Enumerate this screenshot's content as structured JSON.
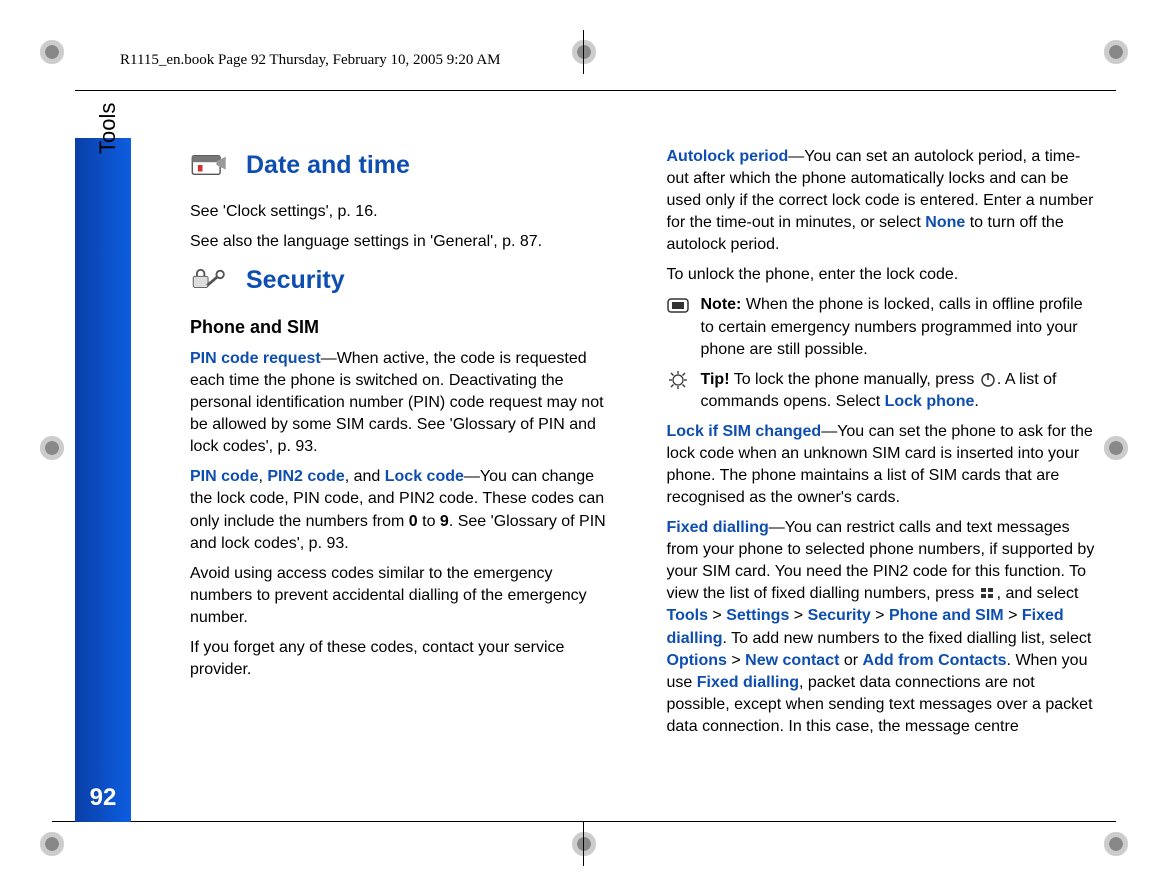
{
  "header": {
    "label": "R1115_en.book  Page 92  Thursday, February 10, 2005  9:20 AM"
  },
  "sidebar": {
    "section": "Tools",
    "page_number": "92"
  },
  "col1": {
    "h_date_time": "Date and time",
    "p_clock": "See 'Clock settings', p. 16.",
    "p_lang": "See also the language settings in 'General', p. 87.",
    "h_security": "Security",
    "h_phone_sim": "Phone and SIM",
    "pin_req_label": "PIN code request",
    "pin_req_text": "—When active, the code is requested each time the phone is switched on. Deactivating the personal identification number (PIN) code request may not be allowed by some SIM cards. See 'Glossary of PIN and lock codes', p. 93.",
    "pin_code": "PIN code",
    "pin2_code": "PIN2 code",
    "and_word": ", and ",
    "lock_code": "Lock code",
    "codes_text": "—You can change the lock code, PIN code, and PIN2 code. These codes can only include the numbers from ",
    "zero": "0",
    "to_word": " to ",
    "nine": "9",
    "codes_text2": ". See 'Glossary of PIN and lock codes', p. 93.",
    "p_avoid": "Avoid using access codes similar to the emergency numbers to prevent accidental dialling of the emergency number.",
    "p_forget": "If you forget any of these codes, contact your service provider."
  },
  "col2": {
    "autolock_label": "Autolock period",
    "autolock_text1": "—You can set an autolock period, a time-out after which the phone automatically locks and can be used only if the correct lock code is entered. Enter a number for the time-out in minutes, or select ",
    "none": "None",
    "autolock_text2": " to turn off the autolock period.",
    "p_unlock": "To unlock the phone, enter the lock code.",
    "note_label": "Note:",
    "note_text": " When the phone is locked, calls in offline profile to certain emergency numbers programmed into your phone are still possible.",
    "tip_label": "Tip!",
    "tip_text1": " To lock the phone manually, press ",
    "tip_text2": ". A list of commands opens. Select ",
    "lock_phone": "Lock phone",
    "dot": ".",
    "lock_sim_label": "Lock if SIM changed",
    "lock_sim_text": "—You can set the phone to ask for the lock code when an unknown SIM card is inserted into your phone. The phone maintains a list of SIM cards that are recognised as the owner's cards.",
    "fixed_label": "Fixed dialling",
    "fixed_text1": "—You can restrict calls and text messages from your phone to selected phone numbers, if supported by your SIM card. You need the PIN2 code for this function. To view the list of fixed dialling numbers, press ",
    "fixed_text2": ", and select ",
    "nav1": "Tools",
    "gt": " > ",
    "nav2": "Settings",
    "nav3": "Security",
    "nav4": "Phone and SIM",
    "nav5": "Fixed dialling",
    "fixed_text3": ". To add new numbers to the fixed dialling list, select ",
    "options": "Options",
    "new_contact": "New contact",
    "or_word": " or ",
    "add_from": "Add from Contacts",
    "fixed_text4": ". When you use ",
    "fixed_text5": ", packet data connections are not possible, except when sending text messages over a packet data connection. In this case, the message centre"
  }
}
